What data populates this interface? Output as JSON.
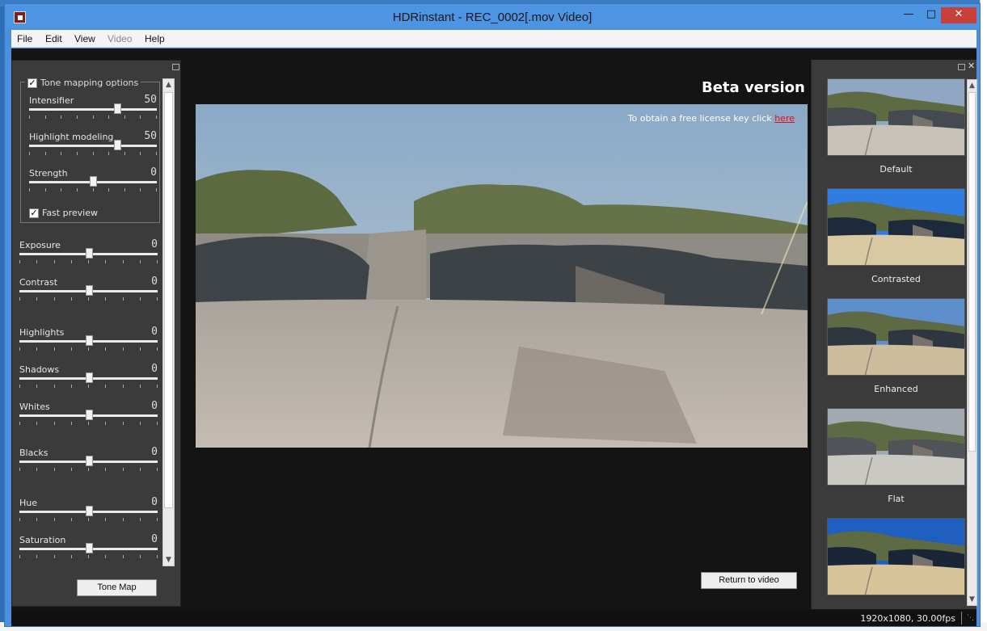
{
  "window": {
    "title": "HDRinstant  -  REC_0002[.mov Video]"
  },
  "menu": [
    "File",
    "Edit",
    "View",
    "Video",
    "Help"
  ],
  "tone_mapping": {
    "group_label": "Tone mapping options",
    "checked": true,
    "sliders": [
      {
        "label": "Intensifier",
        "value": "50",
        "level": 0.69
      },
      {
        "label": "Highlight modeling",
        "value": "50",
        "level": 0.69
      },
      {
        "label": "Strength",
        "value": "0",
        "level": 0.5
      }
    ],
    "fast_preview_label": "Fast preview",
    "fast_preview_checked": true
  },
  "adjustments": [
    {
      "label": "Exposure",
      "value": "0",
      "level": 0.5
    },
    {
      "label": "Contrast",
      "value": "0",
      "level": 0.5
    },
    {
      "label": "Highlights",
      "value": "0",
      "level": 0.5
    },
    {
      "label": "Shadows",
      "value": "0",
      "level": 0.5
    },
    {
      "label": "Whites",
      "value": "0",
      "level": 0.5
    },
    {
      "label": "Blacks",
      "value": "0",
      "level": 0.5
    },
    {
      "label": "Hue",
      "value": "0",
      "level": 0.5
    },
    {
      "label": "Saturation",
      "value": "0",
      "level": 0.5
    }
  ],
  "tone_map_button": "Tone Map",
  "preview": {
    "beta_label": "Beta version",
    "license_text": "To obtain a free license key click ",
    "license_link": "here",
    "return_button": "Return to video"
  },
  "presets": [
    {
      "label": "Default"
    },
    {
      "label": "Contrasted"
    },
    {
      "label": "Enhanced"
    },
    {
      "label": "Flat"
    },
    {
      "label": ""
    }
  ],
  "status": {
    "text": "1920x1080,  30.00fps"
  },
  "colors": {
    "titlebar": "#4d94e3",
    "close": "#c7403a",
    "panel": "#3b3b3b",
    "viewport": "#141414",
    "link": "#dd1111"
  }
}
